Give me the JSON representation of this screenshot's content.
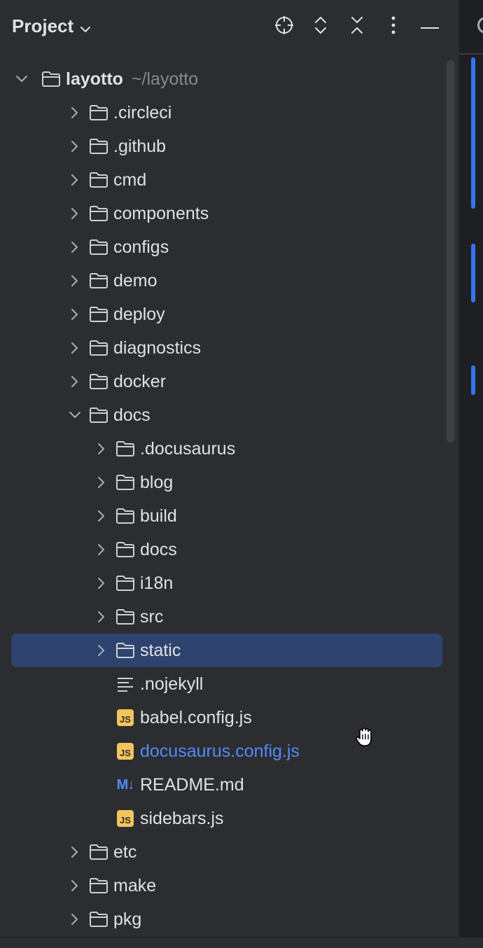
{
  "header": {
    "title": "Project",
    "title_icon": "chevron-down-icon",
    "actions": [
      {
        "name": "select-opened-file-button",
        "icon": "crosshair-icon"
      },
      {
        "name": "expand-all-button",
        "icon": "expand-icon"
      },
      {
        "name": "collapse-all-button",
        "icon": "collapse-icon"
      },
      {
        "name": "options-button",
        "icon": "more-vertical-icon"
      },
      {
        "name": "hide-button",
        "icon": "minimize-icon"
      }
    ]
  },
  "tree": {
    "root": {
      "label": "layotto",
      "hint": "~/layotto"
    },
    "items": [
      {
        "label": ".circleci",
        "type": "folder",
        "depth": 1,
        "expanded": false
      },
      {
        "label": ".github",
        "type": "folder",
        "depth": 1,
        "expanded": false
      },
      {
        "label": "cmd",
        "type": "folder",
        "depth": 1,
        "expanded": false
      },
      {
        "label": "components",
        "type": "folder",
        "depth": 1,
        "expanded": false
      },
      {
        "label": "configs",
        "type": "folder",
        "depth": 1,
        "expanded": false
      },
      {
        "label": "demo",
        "type": "folder",
        "depth": 1,
        "expanded": false
      },
      {
        "label": "deploy",
        "type": "folder",
        "depth": 1,
        "expanded": false
      },
      {
        "label": "diagnostics",
        "type": "folder",
        "depth": 1,
        "expanded": false
      },
      {
        "label": "docker",
        "type": "folder",
        "depth": 1,
        "expanded": false
      },
      {
        "label": "docs",
        "type": "folder",
        "depth": 1,
        "expanded": true
      },
      {
        "label": ".docusaurus",
        "type": "folder",
        "depth": 2,
        "expanded": false
      },
      {
        "label": "blog",
        "type": "folder",
        "depth": 2,
        "expanded": false
      },
      {
        "label": "build",
        "type": "folder",
        "depth": 2,
        "expanded": false
      },
      {
        "label": "docs",
        "type": "folder",
        "depth": 2,
        "expanded": false
      },
      {
        "label": "i18n",
        "type": "folder",
        "depth": 2,
        "expanded": false
      },
      {
        "label": "src",
        "type": "folder",
        "depth": 2,
        "expanded": false
      },
      {
        "label": "static",
        "type": "folder",
        "depth": 2,
        "expanded": false,
        "selected": true
      },
      {
        "label": ".nojekyll",
        "type": "text-file",
        "depth": 2
      },
      {
        "label": "babel.config.js",
        "type": "js-file",
        "depth": 2
      },
      {
        "label": "docusaurus.config.js",
        "type": "js-file",
        "depth": 2,
        "modified": true
      },
      {
        "label": "README.md",
        "type": "md-file",
        "depth": 2
      },
      {
        "label": "sidebars.js",
        "type": "js-file",
        "depth": 2
      },
      {
        "label": "etc",
        "type": "folder",
        "depth": 1,
        "expanded": false
      },
      {
        "label": "make",
        "type": "folder",
        "depth": 1,
        "expanded": false
      },
      {
        "label": "pkg",
        "type": "folder",
        "depth": 1,
        "expanded": false
      }
    ]
  },
  "badges": {
    "js": "JS",
    "md": "M↓"
  },
  "colors": {
    "background": "#2b2d30",
    "selection": "#2e436e",
    "modified_text": "#548af7",
    "js_badge": "#f2c55c",
    "accent": "#3574f0"
  }
}
